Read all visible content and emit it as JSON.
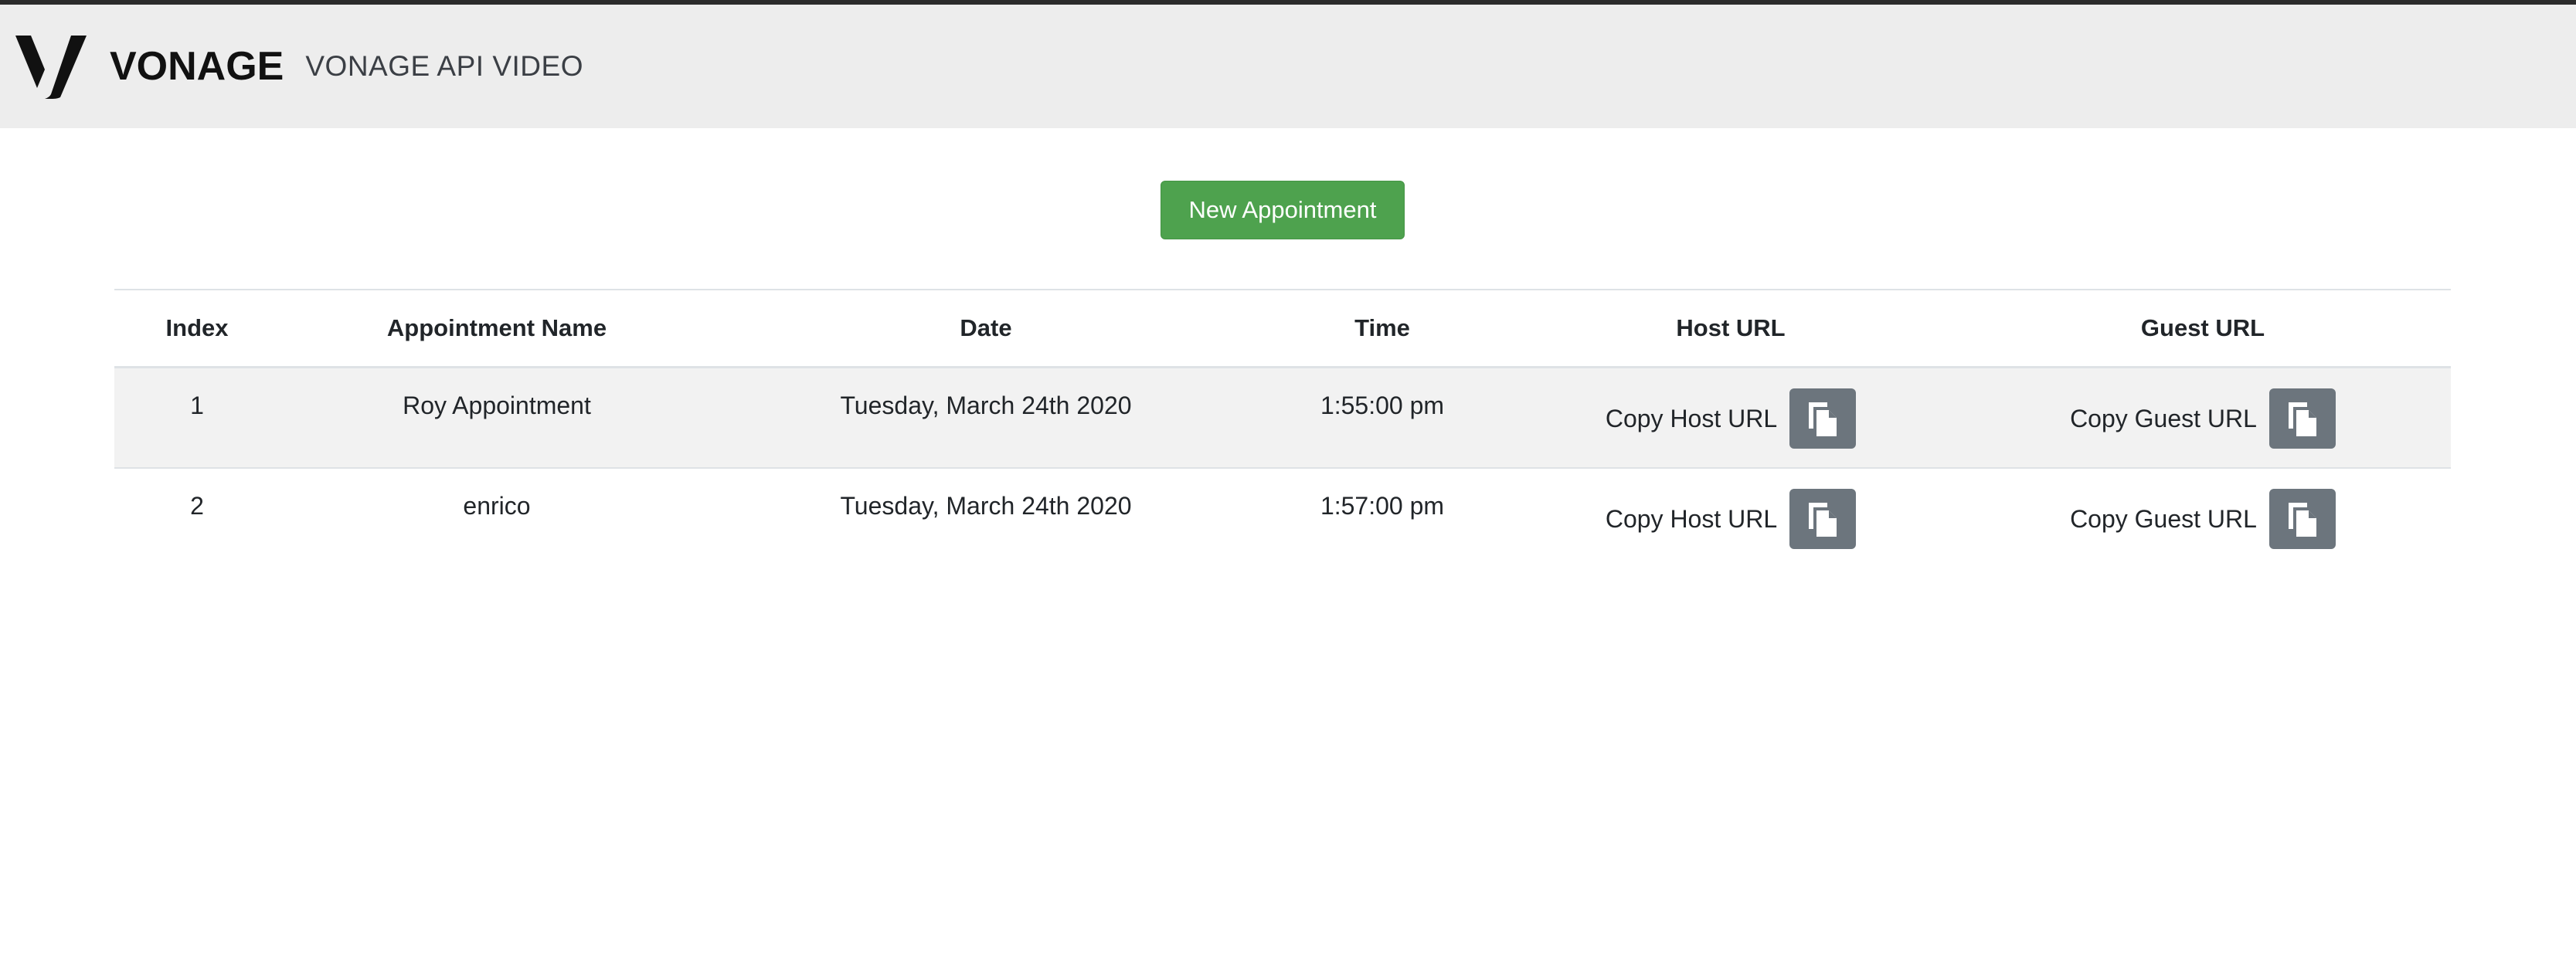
{
  "header": {
    "brand": "VONAGE",
    "product": "VONAGE API VIDEO",
    "logo_icon": "vonage-v-logo-icon",
    "background": "#ededed"
  },
  "toolbar": {
    "new_appointment_label": "New Appointment",
    "new_appointment_color": "#4ea24e"
  },
  "table": {
    "columns": [
      "Index",
      "Appointment Name",
      "Date",
      "Time",
      "Host URL",
      "Guest URL"
    ],
    "rows": [
      {
        "index": "1",
        "name": "Roy Appointment",
        "date": "Tuesday, March 24th 2020",
        "time": "1:55:00 pm",
        "host_label": "Copy Host URL",
        "guest_label": "Copy Guest URL"
      },
      {
        "index": "2",
        "name": "enrico",
        "date": "Tuesday, March 24th 2020",
        "time": "1:57:00 pm",
        "host_label": "Copy Host URL",
        "guest_label": "Copy Guest URL"
      }
    ],
    "copy_button_icon": "copy-icon",
    "copy_button_color": "#6c757d",
    "striped_row_color": "#f2f2f2"
  }
}
